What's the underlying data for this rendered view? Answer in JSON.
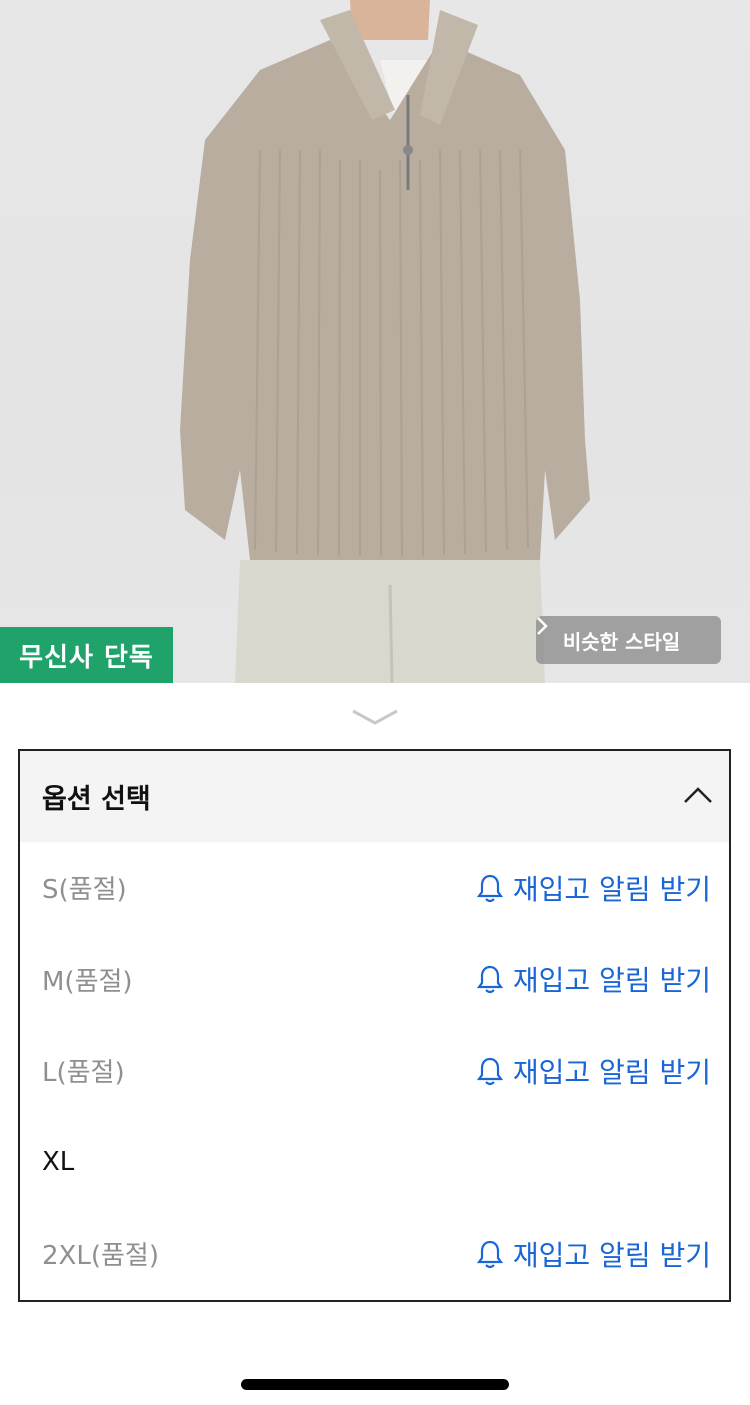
{
  "product_image": {
    "badge_label": "무신사 단독",
    "similar_style_label": "비슷한 스타일",
    "similar_style_icon": "chevron-right-icon"
  },
  "options": {
    "header_label": "옵션 선택",
    "header_icon": "chevron-up-icon",
    "restock_icon": "bell-icon",
    "items": [
      {
        "name": "S(품절)",
        "sold_out": true,
        "restock_label": "재입고 알림 받기"
      },
      {
        "name": "M(품절)",
        "sold_out": true,
        "restock_label": "재입고 알림 받기"
      },
      {
        "name": "L(품절)",
        "sold_out": true,
        "restock_label": "재입고 알림 받기"
      },
      {
        "name": "XL",
        "sold_out": false,
        "restock_label": ""
      },
      {
        "name": "2XL(품절)",
        "sold_out": true,
        "restock_label": "재입고 알림 받기"
      }
    ]
  },
  "colors": {
    "badge": "#1fa36b",
    "link": "#1a66d6",
    "sold_out_text": "#8f8f8f"
  }
}
